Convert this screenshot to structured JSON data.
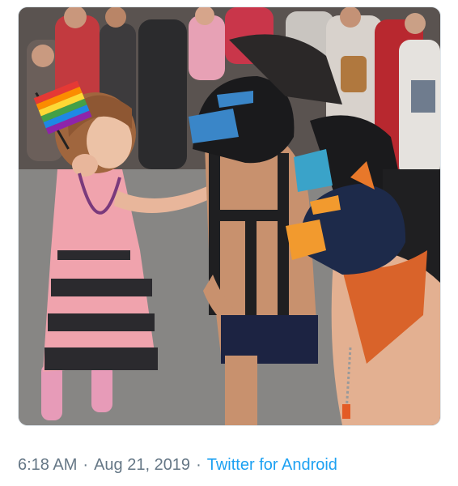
{
  "tweet": {
    "time": "6:18 AM",
    "separator": "·",
    "date": "Aug 21, 2019",
    "source": "Twitter for Android",
    "colors": {
      "meta_text": "#657786",
      "link": "#1da1f2",
      "card_border": "#e1e8ed"
    },
    "media": {
      "kind": "photo"
    }
  }
}
